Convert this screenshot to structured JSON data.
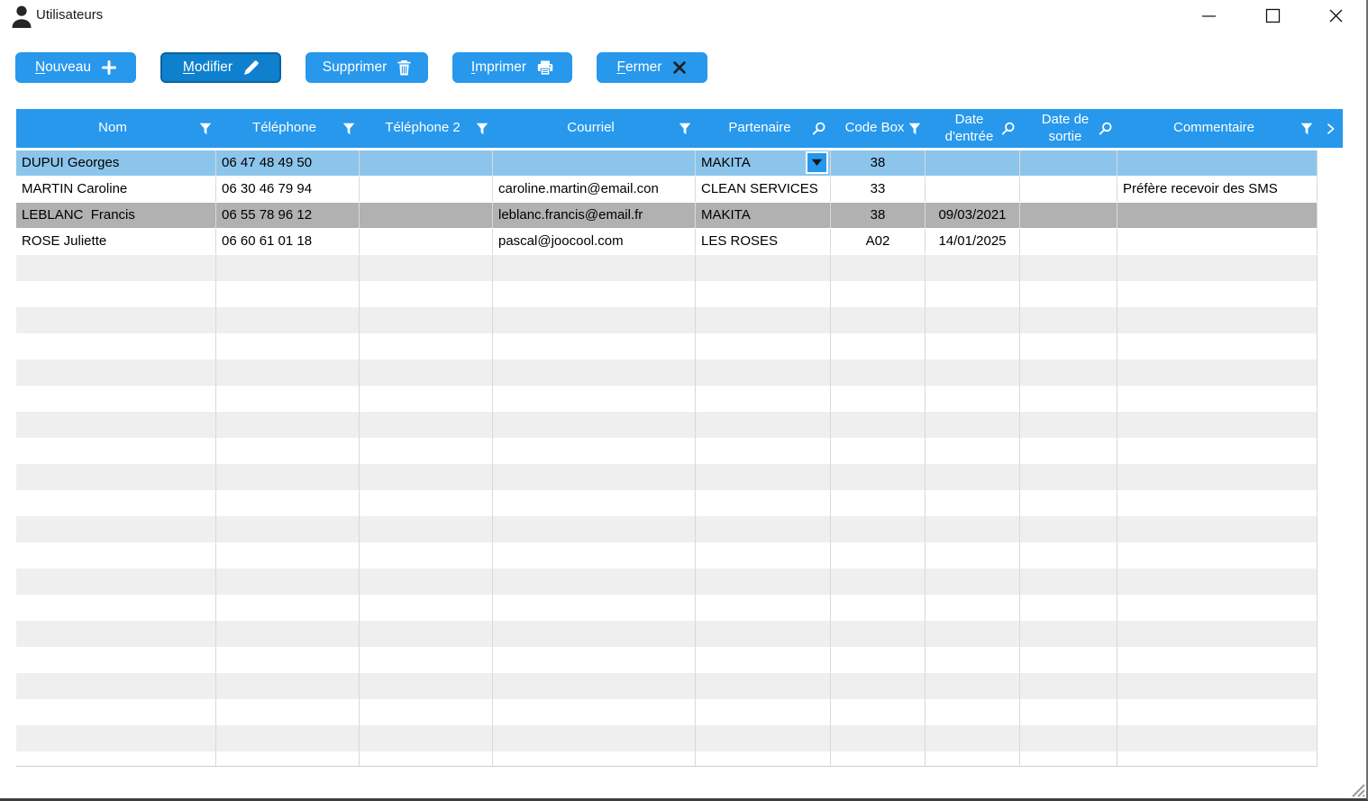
{
  "window": {
    "title": "Utilisateurs",
    "icon": "person-icon",
    "controls": [
      {
        "name": "minimize",
        "icon": "minimize-icon"
      },
      {
        "name": "maximize",
        "icon": "maximize-icon"
      },
      {
        "name": "close",
        "icon": "window-close-icon"
      }
    ]
  },
  "toolbar": {
    "buttons": [
      {
        "id": "nouveau",
        "label": "Nouveau",
        "mnemonic": "N",
        "icon": "plus-icon",
        "active": false
      },
      {
        "id": "modifier",
        "label": "Modifier",
        "mnemonic": "M",
        "icon": "pencil-icon",
        "active": true
      },
      {
        "id": "supprimer",
        "label": "Supprimer",
        "mnemonic": "",
        "icon": "trash-icon",
        "active": false
      },
      {
        "id": "imprimer",
        "label": "Imprimer",
        "mnemonic": "I",
        "icon": "printer-icon",
        "active": false
      },
      {
        "id": "fermer",
        "label": "Fermer",
        "mnemonic": "F",
        "icon": "close-x-icon",
        "active": false
      }
    ]
  },
  "table": {
    "columns": [
      {
        "id": "nom",
        "label": "Nom",
        "icon": "filter-icon",
        "align": "left"
      },
      {
        "id": "telephone",
        "label": "Téléphone",
        "icon": "filter-icon",
        "align": "left"
      },
      {
        "id": "telephone2",
        "label": "Téléphone 2",
        "icon": "filter-icon",
        "align": "left"
      },
      {
        "id": "courriel",
        "label": "Courriel",
        "icon": "filter-icon",
        "align": "left"
      },
      {
        "id": "partenaire",
        "label": "Partenaire",
        "icon": "search-icon",
        "align": "left"
      },
      {
        "id": "codebox",
        "label": "Code Box",
        "icon": "filter-icon",
        "align": "center"
      },
      {
        "id": "date_entree",
        "label": "Date\nd'entrée",
        "icon": "search-icon",
        "align": "center"
      },
      {
        "id": "date_sortie",
        "label": "Date de\nsortie",
        "icon": "search-icon",
        "align": "center"
      },
      {
        "id": "commentaire",
        "label": "Commentaire",
        "icon": "filter-icon",
        "align": "left"
      }
    ],
    "more_columns_icon": "chevron-right-icon",
    "rows": [
      {
        "state": "selected",
        "dropdown_col": 4,
        "cells": [
          "DUPUI Georges",
          "06 47 48 49 50",
          "",
          "",
          "MAKITA",
          "38",
          "",
          "",
          ""
        ]
      },
      {
        "state": "normal",
        "cells": [
          "MARTIN Caroline",
          "06 30 46 79 94",
          "",
          "caroline.martin@email.con",
          "CLEAN SERVICES",
          "33",
          "",
          "",
          "Préfère recevoir des SMS"
        ]
      },
      {
        "state": "marked",
        "cells": [
          "LEBLANC  Francis",
          "06 55 78 96 12",
          "",
          "leblanc.francis@email.fr",
          "MAKITA",
          "38",
          "09/03/2021",
          "",
          ""
        ]
      },
      {
        "state": "normal",
        "cells": [
          "ROSE Juliette",
          "06 60 61 01 18",
          "",
          "pascal@joocool.com",
          "LES ROSES",
          "A02",
          "14/01/2025",
          "",
          ""
        ]
      }
    ],
    "empty_row_count": 20
  },
  "colors": {
    "accent": "#2798ec",
    "accent_dark": "#0e80ce",
    "header_text": "#ffffff",
    "row_selected": "#8cc5eb",
    "row_marked": "#b2b1b1",
    "row_stripe": "#efefef",
    "grid_line": "#d9d9d9"
  }
}
